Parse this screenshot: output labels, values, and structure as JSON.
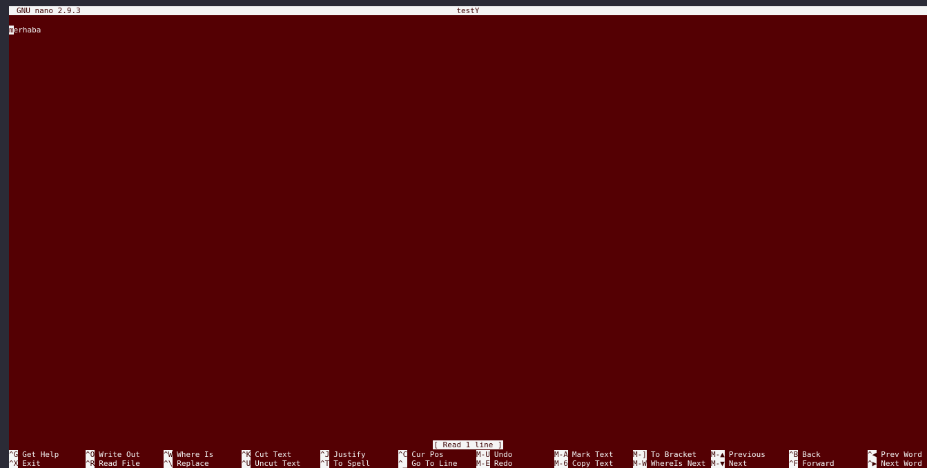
{
  "title_bar": {
    "app": "GNU nano 2.9.3",
    "filename": "testY"
  },
  "editor": {
    "cursor_char": "m",
    "line_rest": "erhaba"
  },
  "status": "[ Read 1 line ]",
  "shortcuts_row1": [
    {
      "key": "^G",
      "label": "Get Help"
    },
    {
      "key": "^O",
      "label": "Write Out"
    },
    {
      "key": "^W",
      "label": "Where Is"
    },
    {
      "key": "^K",
      "label": "Cut Text"
    },
    {
      "key": "^J",
      "label": "Justify"
    },
    {
      "key": "^C",
      "label": "Cur Pos"
    },
    {
      "key": "M-U",
      "label": "Undo"
    },
    {
      "key": "M-A",
      "label": "Mark Text"
    },
    {
      "key": "M-]",
      "label": "To Bracket"
    },
    {
      "key": "M-▲",
      "label": "Previous"
    },
    {
      "key": "^B",
      "label": "Back"
    },
    {
      "key": "^◀",
      "label": "Prev Word"
    }
  ],
  "shortcuts_row2": [
    {
      "key": "^X",
      "label": "Exit"
    },
    {
      "key": "^R",
      "label": "Read File"
    },
    {
      "key": "^\\",
      "label": "Replace"
    },
    {
      "key": "^U",
      "label": "Uncut Text"
    },
    {
      "key": "^T",
      "label": "To Spell"
    },
    {
      "key": "^_",
      "label": "Go To Line"
    },
    {
      "key": "M-E",
      "label": "Redo"
    },
    {
      "key": "M-6",
      "label": "Copy Text"
    },
    {
      "key": "M-W",
      "label": "WhereIs Next"
    },
    {
      "key": "M-▼",
      "label": "Next"
    },
    {
      "key": "^F",
      "label": "Forward"
    },
    {
      "key": "^▶",
      "label": "Next Word"
    }
  ]
}
